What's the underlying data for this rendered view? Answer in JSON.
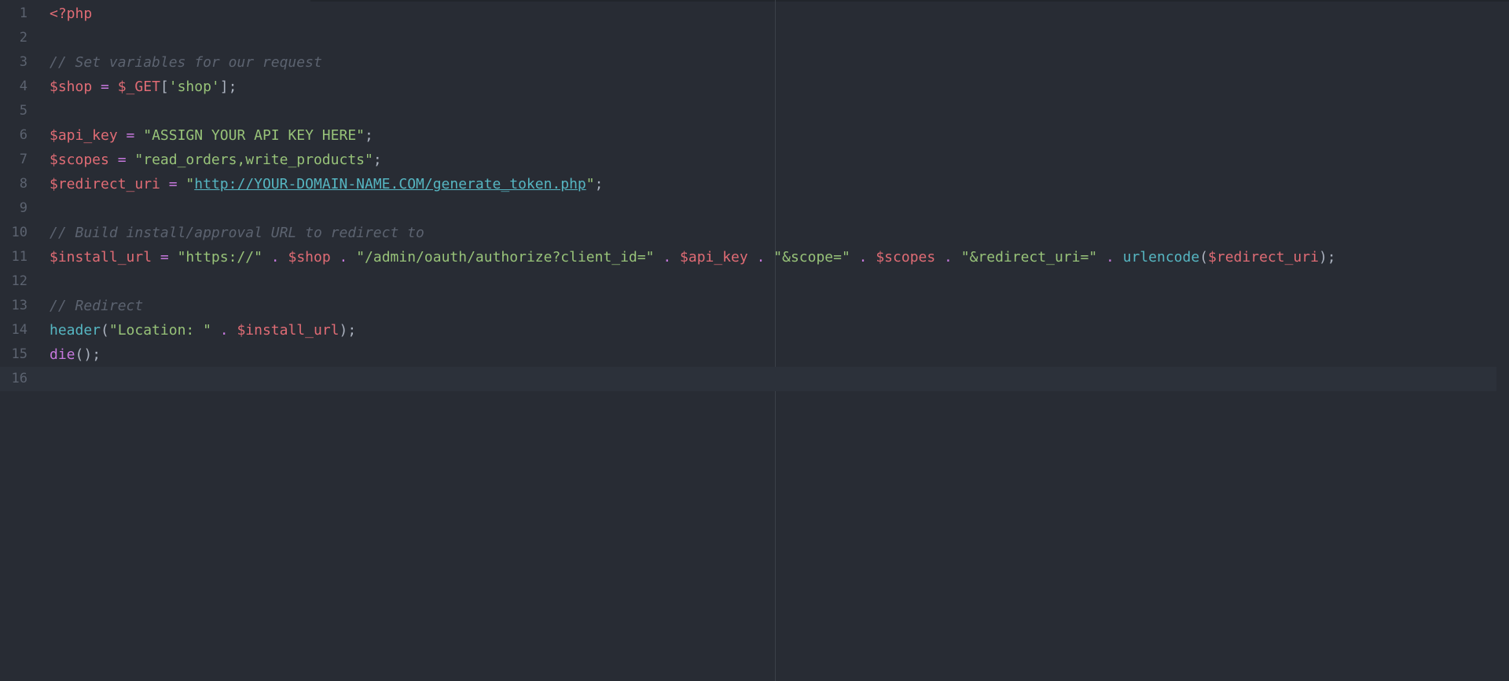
{
  "editor": {
    "language": "php",
    "lines": [
      {
        "number": "1",
        "tokens": [
          {
            "t": "<?php",
            "k": "tag"
          }
        ]
      },
      {
        "number": "2",
        "tokens": []
      },
      {
        "number": "3",
        "tokens": [
          {
            "t": "// Set variables for our request",
            "k": "comment"
          }
        ]
      },
      {
        "number": "4",
        "tokens": [
          {
            "t": "$shop",
            "k": "var"
          },
          {
            "t": " ",
            "k": "punct"
          },
          {
            "t": "=",
            "k": "op"
          },
          {
            "t": " ",
            "k": "punct"
          },
          {
            "t": "$_GET",
            "k": "var"
          },
          {
            "t": "[",
            "k": "punct"
          },
          {
            "t": "'shop'",
            "k": "str"
          },
          {
            "t": "];",
            "k": "punct"
          }
        ]
      },
      {
        "number": "5",
        "tokens": []
      },
      {
        "number": "6",
        "tokens": [
          {
            "t": "$api_key",
            "k": "var"
          },
          {
            "t": " ",
            "k": "punct"
          },
          {
            "t": "=",
            "k": "op"
          },
          {
            "t": " ",
            "k": "punct"
          },
          {
            "t": "\"ASSIGN YOUR API KEY HERE\"",
            "k": "str"
          },
          {
            "t": ";",
            "k": "punct"
          }
        ]
      },
      {
        "number": "7",
        "tokens": [
          {
            "t": "$scopes",
            "k": "var"
          },
          {
            "t": " ",
            "k": "punct"
          },
          {
            "t": "=",
            "k": "op"
          },
          {
            "t": " ",
            "k": "punct"
          },
          {
            "t": "\"read_orders,write_products\"",
            "k": "str"
          },
          {
            "t": ";",
            "k": "punct"
          }
        ]
      },
      {
        "number": "8",
        "tokens": [
          {
            "t": "$redirect_uri",
            "k": "var"
          },
          {
            "t": " ",
            "k": "punct"
          },
          {
            "t": "=",
            "k": "op"
          },
          {
            "t": " ",
            "k": "punct"
          },
          {
            "t": "\"",
            "k": "str"
          },
          {
            "t": "http://YOUR-DOMAIN-NAME.COM/generate_token.php",
            "k": "link"
          },
          {
            "t": "\"",
            "k": "str"
          },
          {
            "t": ";",
            "k": "punct"
          }
        ]
      },
      {
        "number": "9",
        "tokens": []
      },
      {
        "number": "10",
        "tokens": [
          {
            "t": "// Build install/approval URL to redirect to",
            "k": "comment"
          }
        ]
      },
      {
        "number": "11",
        "tokens": [
          {
            "t": "$install_url",
            "k": "var"
          },
          {
            "t": " ",
            "k": "punct"
          },
          {
            "t": "=",
            "k": "op"
          },
          {
            "t": " ",
            "k": "punct"
          },
          {
            "t": "\"https://\"",
            "k": "str"
          },
          {
            "t": " ",
            "k": "punct"
          },
          {
            "t": ".",
            "k": "op"
          },
          {
            "t": " ",
            "k": "punct"
          },
          {
            "t": "$shop",
            "k": "var"
          },
          {
            "t": " ",
            "k": "punct"
          },
          {
            "t": ".",
            "k": "op"
          },
          {
            "t": " ",
            "k": "punct"
          },
          {
            "t": "\"/admin/oauth/authorize?client_id=\"",
            "k": "str"
          },
          {
            "t": " ",
            "k": "punct"
          },
          {
            "t": ".",
            "k": "op"
          },
          {
            "t": " ",
            "k": "punct"
          },
          {
            "t": "$api_key",
            "k": "var"
          },
          {
            "t": " ",
            "k": "punct"
          },
          {
            "t": ".",
            "k": "op"
          },
          {
            "t": " ",
            "k": "punct"
          },
          {
            "t": "\"&scope=\"",
            "k": "str"
          },
          {
            "t": " ",
            "k": "punct"
          },
          {
            "t": ".",
            "k": "op"
          },
          {
            "t": " ",
            "k": "punct"
          },
          {
            "t": "$scopes",
            "k": "var"
          },
          {
            "t": " ",
            "k": "punct"
          },
          {
            "t": ".",
            "k": "op"
          },
          {
            "t": " ",
            "k": "punct"
          },
          {
            "t": "\"&redirect_uri=\"",
            "k": "str"
          },
          {
            "t": " ",
            "k": "punct"
          },
          {
            "t": ".",
            "k": "op"
          },
          {
            "t": " ",
            "k": "punct"
          },
          {
            "t": "urlencode",
            "k": "func"
          },
          {
            "t": "(",
            "k": "punct"
          },
          {
            "t": "$redirect_uri",
            "k": "var"
          },
          {
            "t": ");",
            "k": "punct"
          }
        ]
      },
      {
        "number": "12",
        "tokens": []
      },
      {
        "number": "13",
        "tokens": [
          {
            "t": "// Redirect",
            "k": "comment"
          }
        ]
      },
      {
        "number": "14",
        "tokens": [
          {
            "t": "header",
            "k": "func"
          },
          {
            "t": "(",
            "k": "punct"
          },
          {
            "t": "\"Location: \"",
            "k": "str"
          },
          {
            "t": " ",
            "k": "punct"
          },
          {
            "t": ".",
            "k": "op"
          },
          {
            "t": " ",
            "k": "punct"
          },
          {
            "t": "$install_url",
            "k": "var"
          },
          {
            "t": ");",
            "k": "punct"
          }
        ]
      },
      {
        "number": "15",
        "tokens": [
          {
            "t": "die",
            "k": "kw"
          },
          {
            "t": "();",
            "k": "punct"
          }
        ]
      },
      {
        "number": "16",
        "tokens": [],
        "cursor": true
      }
    ]
  }
}
